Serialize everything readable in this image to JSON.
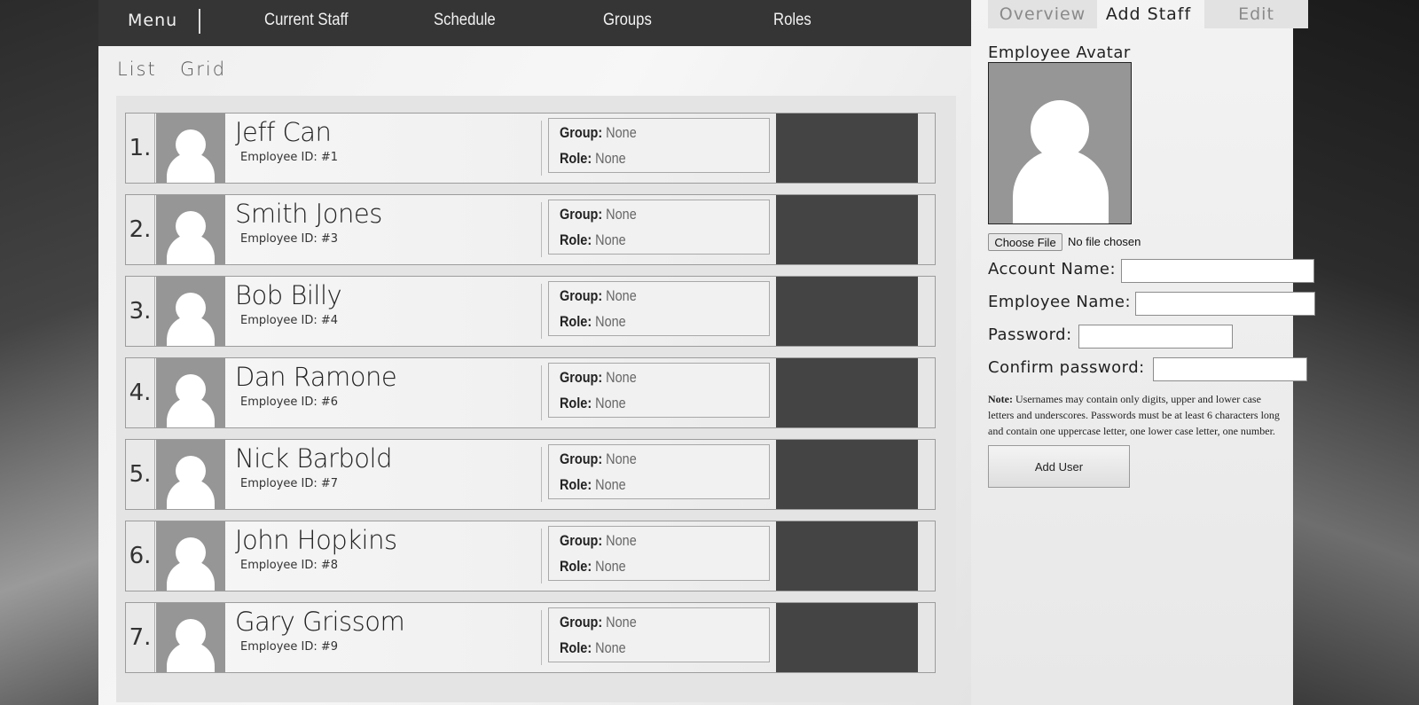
{
  "topnav": {
    "menu_label": "Menu",
    "links": [
      "Current Staff",
      "Schedule",
      "Groups",
      "Roles"
    ]
  },
  "view_toggle": {
    "list": "List",
    "grid": "Grid"
  },
  "employees": [
    {
      "num": "1.",
      "name": "Jeff Can",
      "id_label": "Employee ID: #1",
      "group_label": "Group:",
      "group": "None",
      "role_label": "Role:",
      "role": "None"
    },
    {
      "num": "2.",
      "name": "Smith Jones",
      "id_label": "Employee ID: #3",
      "group_label": "Group:",
      "group": "None",
      "role_label": "Role:",
      "role": "None"
    },
    {
      "num": "3.",
      "name": "Bob Billy",
      "id_label": "Employee ID: #4",
      "group_label": "Group:",
      "group": "None",
      "role_label": "Role:",
      "role": "None"
    },
    {
      "num": "4.",
      "name": "Dan Ramone",
      "id_label": "Employee ID: #6",
      "group_label": "Group:",
      "group": "None",
      "role_label": "Role:",
      "role": "None"
    },
    {
      "num": "5.",
      "name": "Nick Barbold",
      "id_label": "Employee ID: #7",
      "group_label": "Group:",
      "group": "None",
      "role_label": "Role:",
      "role": "None"
    },
    {
      "num": "6.",
      "name": "John Hopkins",
      "id_label": "Employee ID: #8",
      "group_label": "Group:",
      "group": "None",
      "role_label": "Role:",
      "role": "None"
    },
    {
      "num": "7.",
      "name": "Gary Grissom",
      "id_label": "Employee ID: #9",
      "group_label": "Group:",
      "group": "None",
      "role_label": "Role:",
      "role": "None"
    }
  ],
  "side": {
    "tabs": [
      "Overview",
      "Add Staff",
      "Edit"
    ],
    "active_tab": "Add Staff",
    "avatar_label": "Employee Avatar",
    "file_button": "Choose File",
    "file_status": "No file chosen",
    "account_name_label": "Account Name:",
    "account_name_value": "",
    "employee_name_label": "Employee Name:",
    "employee_name_value": "",
    "password_label": "Password:",
    "password_value": "",
    "confirm_password_label": "Confirm password:",
    "confirm_password_value": "",
    "note_title": "Note:",
    "note_text": " Usernames may contain only digits, upper and lower case letters and underscores. Passwords must be at least 6 characters long and contain one uppercase letter, one lower case letter, one number.",
    "add_button": "Add User"
  },
  "colors": {
    "nav_bg": "#353535",
    "row_dark_panel": "#444444",
    "avatar_gray": "#969696"
  }
}
